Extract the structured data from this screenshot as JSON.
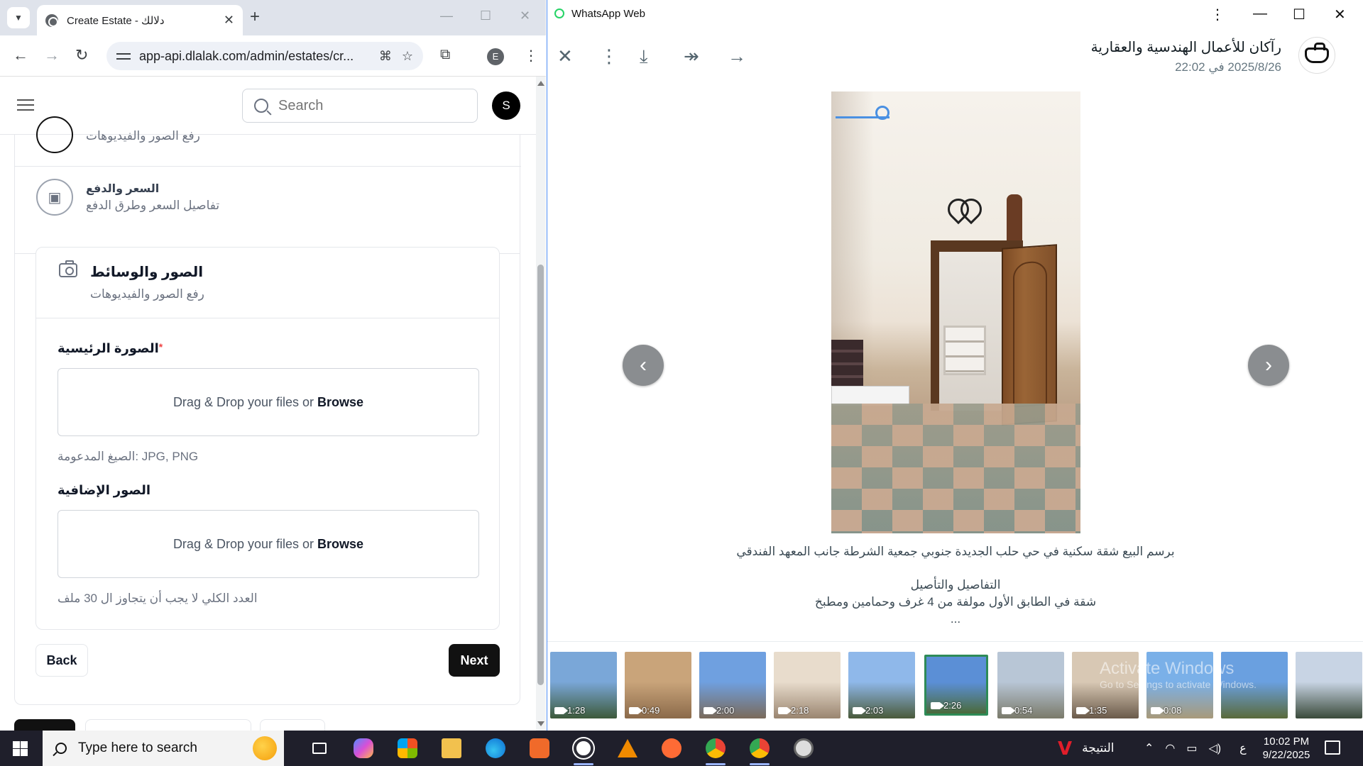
{
  "chrome": {
    "tab_title": "Create Estate - دلالك",
    "url": "app-api.dlalak.com/admin/estates/cr...",
    "profile_initial": "E"
  },
  "app": {
    "search_placeholder": "Search",
    "user_initial": "S",
    "steps": [
      {
        "title": "",
        "subtitle": "رفع الصور والفيديوهات",
        "icon": "camera-icon"
      },
      {
        "title": "السعر والدفع",
        "subtitle": "تفاصيل السعر وطرق الدفع",
        "icon": "money-icon"
      }
    ],
    "media_card": {
      "title": "الصور والوسائط",
      "subtitle": "رفع الصور والفيديوهات",
      "main_image_label": "الصورة الرئيسية",
      "required_mark": "*",
      "drop_text": "Drag & Drop your files or",
      "browse_text": "Browse",
      "main_hint": "الصيغ المدعومة: JPG, PNG",
      "extra_images_label": "الصور الإضافية",
      "extra_hint": "العدد الكلي لا يجب أن يتجاوز ال 30 ملف"
    },
    "back_label": "Back",
    "next_label": "Next"
  },
  "whatsapp": {
    "window_title": "WhatsApp Web",
    "sender_name": "رآكان للأعمال الهندسية والعقارية",
    "sent_time": "2025/8/26 في 22:02",
    "caption_lines": [
      "برسم البيع شقة سكنية في حي حلب الجديدة جنوبي جمعية الشرطة جانب المعهد الفندقي",
      "",
      "التفاصيل والتأصيل",
      "شقة في الطابق الأول  مولفة من 4 غرف وحمامين ومطبخ",
      "..."
    ],
    "thumbnails": [
      {
        "duration": "1:28",
        "colors": [
          "#7aa7d8",
          "#3d5a3a"
        ]
      },
      {
        "duration": "0:49",
        "colors": [
          "#c9a47a",
          "#8b6a4a"
        ]
      },
      {
        "duration": "2:00",
        "colors": [
          "#6fa0e0",
          "#7a6a5a"
        ]
      },
      {
        "duration": "2:18",
        "colors": [
          "#e8dccc",
          "#9a8570"
        ]
      },
      {
        "duration": "2:03",
        "colors": [
          "#8fb8ea",
          "#4a5a3a"
        ]
      },
      {
        "duration": "2:26",
        "colors": [
          "#5b8fd6",
          "#4a6a3a"
        ],
        "selected": true
      },
      {
        "duration": "0:54",
        "colors": [
          "#b8c6d6",
          "#7a7a6a"
        ]
      },
      {
        "duration": "1:35",
        "colors": [
          "#d8c8b4",
          "#6a5a4a"
        ]
      },
      {
        "duration": "0:08",
        "colors": [
          "#7ab0e8",
          "#a89a7a"
        ]
      },
      {
        "duration": "",
        "colors": [
          "#6aa0e0",
          "#5a6a3a"
        ]
      },
      {
        "duration": "",
        "colors": [
          "#c8d4e4",
          "#3a4a3a"
        ]
      }
    ],
    "activate_title": "Activate Windows",
    "activate_sub": "Go to Settings to activate Windows."
  },
  "taskbar": {
    "search_placeholder": "Type here to search",
    "weather_label": "النتيجة",
    "lang": "ع",
    "time": "10:02 PM",
    "date": "9/22/2025"
  }
}
